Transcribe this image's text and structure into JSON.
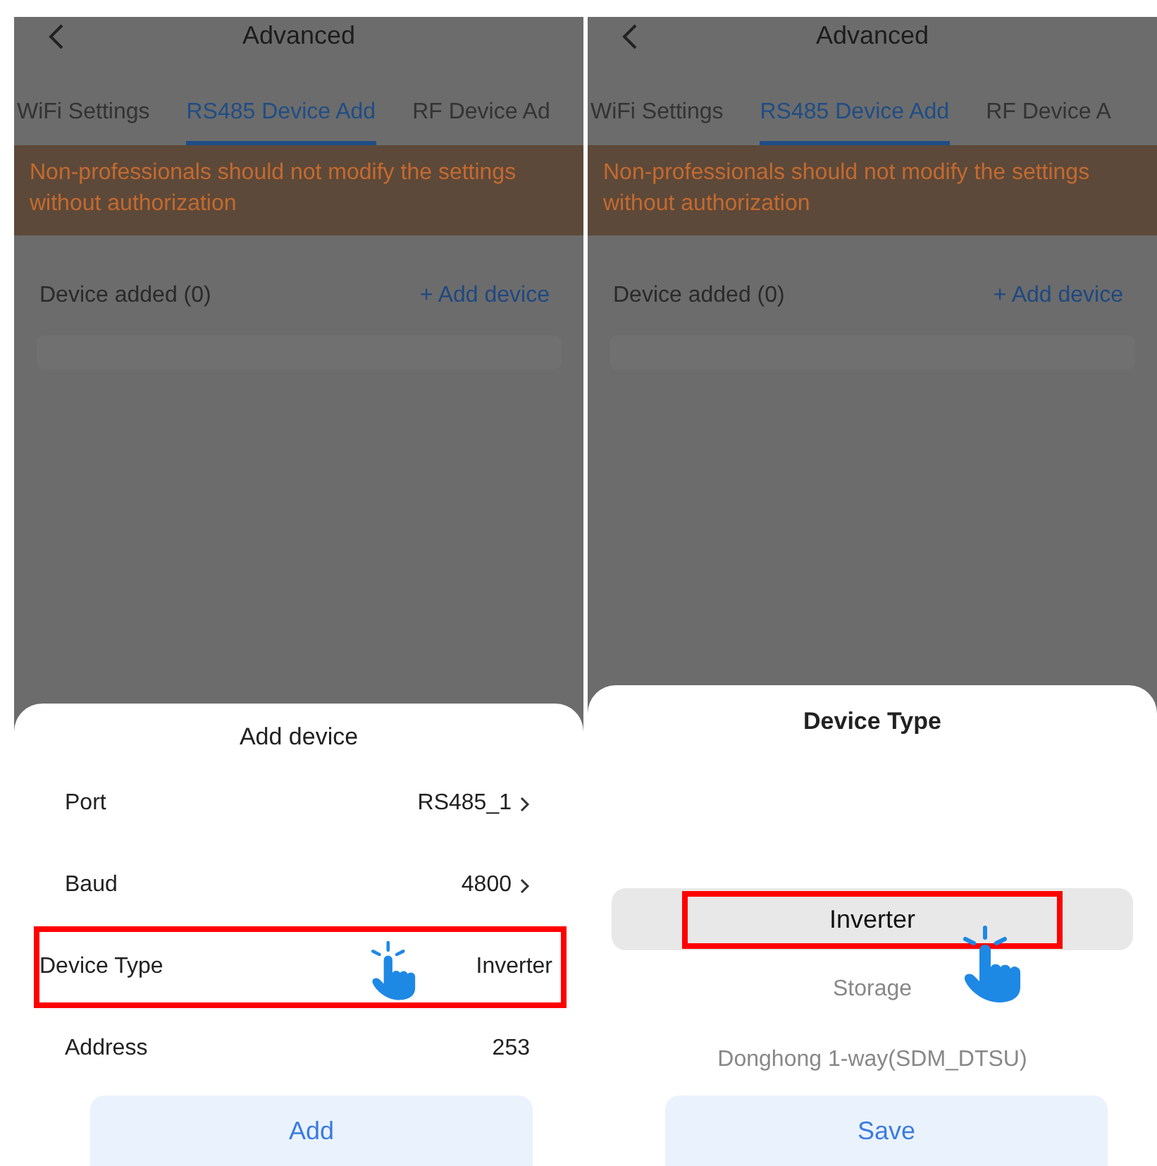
{
  "panels": [
    {
      "header": {
        "title": "Advanced"
      },
      "tabs": [
        {
          "label": "WiFi Settings",
          "selected": false
        },
        {
          "label": "RS485 Device Add",
          "selected": true
        },
        {
          "label": "RF Device Ad",
          "selected": false
        }
      ],
      "warning": "Non-professionals should not modify the settings without authorization",
      "devices": {
        "label": "Device added (0)",
        "add_link": "+ Add device"
      },
      "sheet": {
        "kind": "form",
        "title": "Add device",
        "rows": [
          {
            "label": "Port",
            "value": "RS485_1",
            "chevron": true,
            "highlighted": false
          },
          {
            "label": "Baud",
            "value": "4800",
            "chevron": true,
            "highlighted": false
          },
          {
            "label": "Device Type",
            "value": "Inverter",
            "chevron": false,
            "highlighted": true
          },
          {
            "label": "Address",
            "value": "253",
            "chevron": false,
            "highlighted": false
          }
        ],
        "button": "Add"
      }
    },
    {
      "header": {
        "title": "Advanced"
      },
      "tabs": [
        {
          "label": "WiFi Settings",
          "selected": false
        },
        {
          "label": "RS485 Device Add",
          "selected": true
        },
        {
          "label": "RF Device A",
          "selected": false
        }
      ],
      "warning": "Non-professionals should not modify the settings without authorization",
      "devices": {
        "label": "Device added (0)",
        "add_link": "+ Add device"
      },
      "sheet": {
        "kind": "picker",
        "title": "Device Type",
        "options": [
          {
            "label": "Inverter",
            "selected": true,
            "highlighted": true
          },
          {
            "label": "Storage",
            "selected": false,
            "highlighted": false
          },
          {
            "label": "Donghong 1-way(SDM_DTSU)",
            "selected": false,
            "highlighted": false
          }
        ],
        "button": "Save"
      }
    }
  ]
}
